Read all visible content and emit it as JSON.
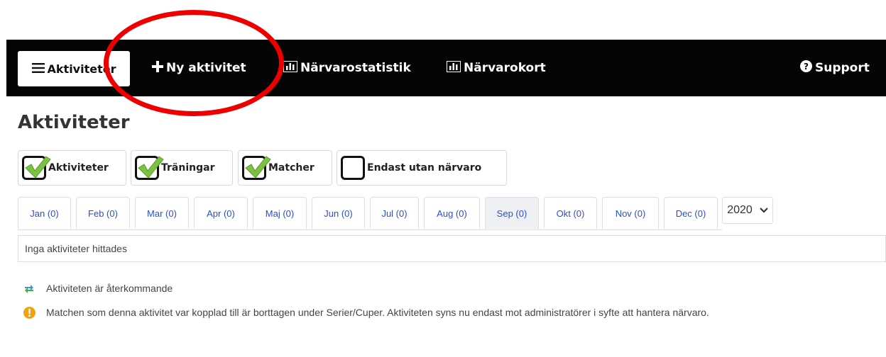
{
  "navbar": {
    "activities_label": "Aktiviteter",
    "new_activity_label": "Ny aktivitet",
    "attendance_stats_label": "Närvarostatistik",
    "attendance_cards_label": "Närvarokort",
    "support_label": "Support"
  },
  "page_title": "Aktiviteter",
  "filters": [
    {
      "label": "Aktiviteter",
      "checked": true
    },
    {
      "label": "Träningar",
      "checked": true
    },
    {
      "label": "Matcher",
      "checked": true
    },
    {
      "label": "Endast utan närvaro",
      "checked": false
    }
  ],
  "months": [
    "Jan (0)",
    "Feb (0)",
    "Mar (0)",
    "Apr (0)",
    "Maj (0)",
    "Jun (0)",
    "Jul (0)",
    "Aug (0)",
    "Sep (0)",
    "Okt (0)",
    "Nov (0)",
    "Dec (0)"
  ],
  "selected_month": "Sep (0)",
  "year": "2020",
  "empty_message": "Inga aktiviteter hittades",
  "legend": {
    "recurring": "Aktiviteten är återkommande",
    "removed_match": "Matchen som denna aktivitet var kopplad till är borttagen under Serier/Cuper. Aktiviteten syns nu endast mot administratörer i syfte att hantera närvaro."
  },
  "colors": {
    "navbar": "#050505",
    "month_link": "#2a4fd0",
    "check_green": "#7cc242",
    "annotation_red": "#ee0000",
    "warning": "#f0a30a"
  }
}
